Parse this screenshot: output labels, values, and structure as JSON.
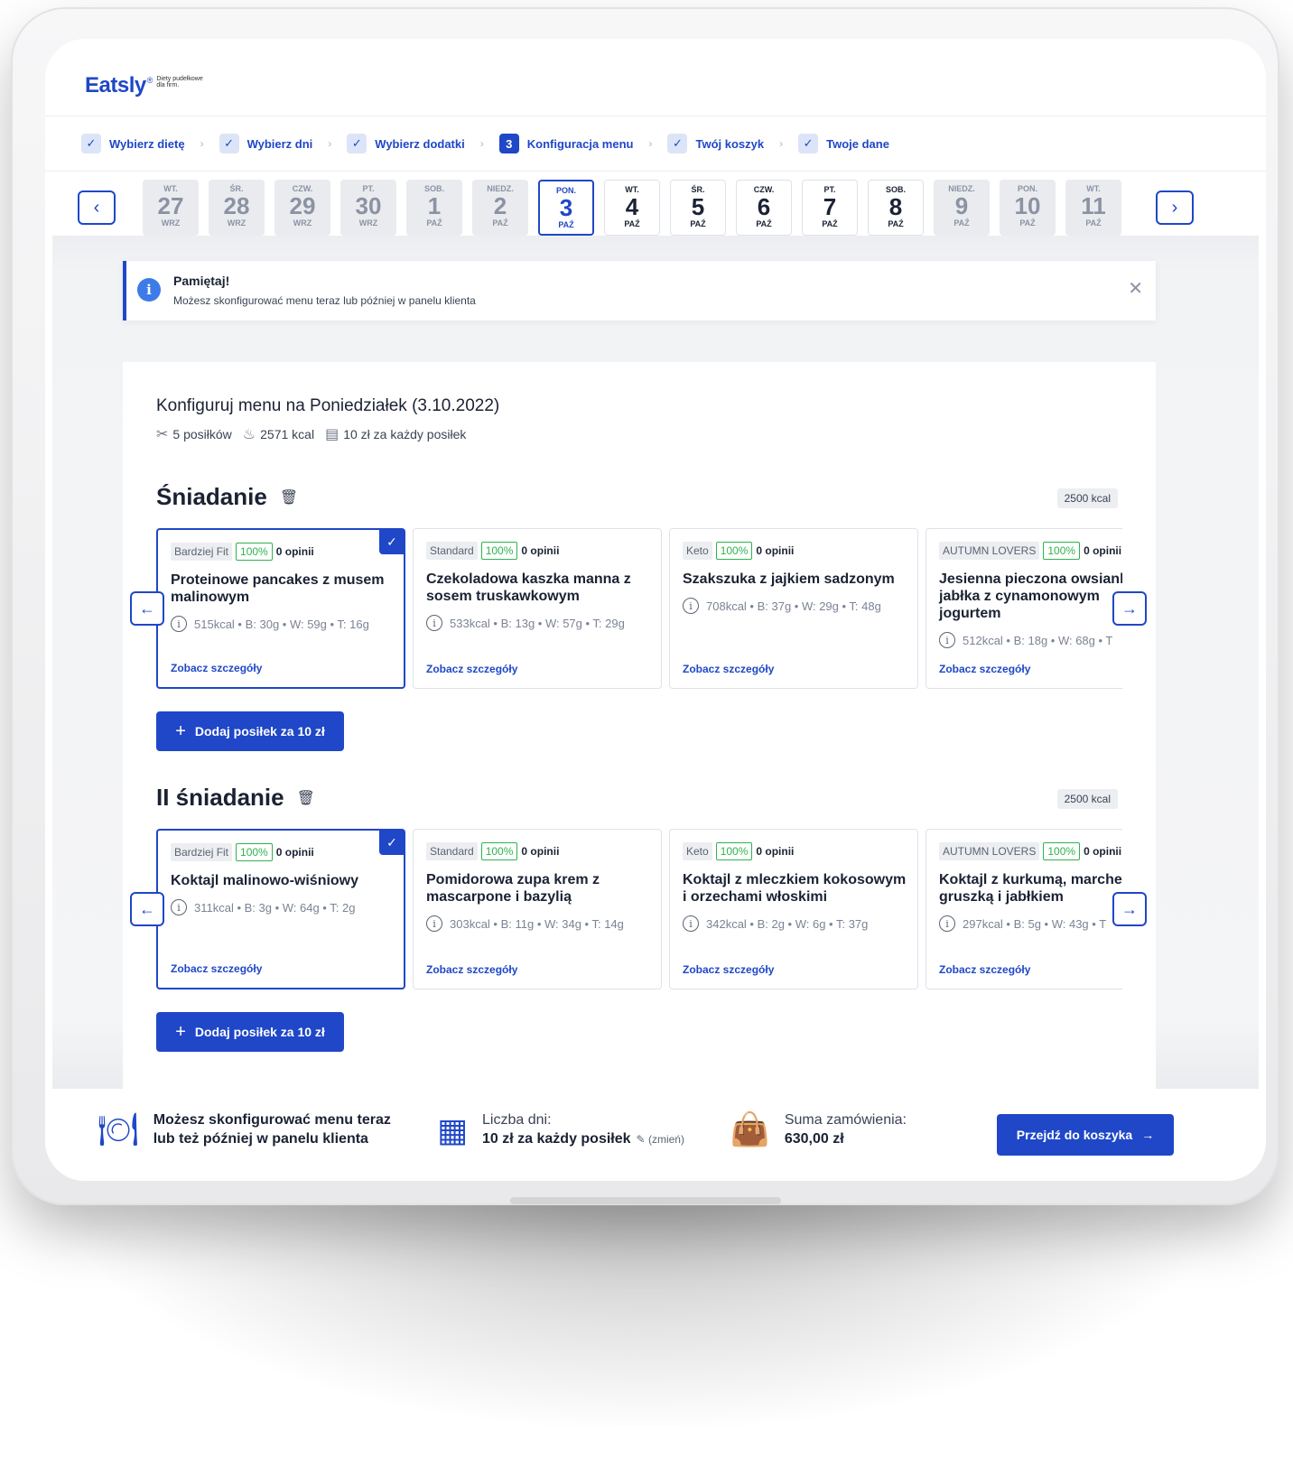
{
  "brand": {
    "name": "Eatsly",
    "reg": "®",
    "tagline": "Diety pudełkowe dla firm."
  },
  "steps": [
    {
      "label": "Wybierz dietę",
      "state": "done",
      "mark": "✓"
    },
    {
      "label": "Wybierz dni",
      "state": "done",
      "mark": "✓"
    },
    {
      "label": "Wybierz dodatki",
      "state": "done",
      "mark": "✓"
    },
    {
      "label": "Konfiguracja menu",
      "state": "current",
      "mark": "3"
    },
    {
      "label": "Twój koszyk",
      "state": "done",
      "mark": "✓"
    },
    {
      "label": "Twoje dane",
      "state": "done",
      "mark": "✓"
    }
  ],
  "days": [
    {
      "name": "WT.",
      "day": "27",
      "month": "WRZ",
      "state": "past"
    },
    {
      "name": "ŚR.",
      "day": "28",
      "month": "WRZ",
      "state": "past"
    },
    {
      "name": "CZW.",
      "day": "29",
      "month": "WRZ",
      "state": "past"
    },
    {
      "name": "PT.",
      "day": "30",
      "month": "WRZ",
      "state": "past"
    },
    {
      "name": "SOB.",
      "day": "1",
      "month": "PAŹ",
      "state": "past"
    },
    {
      "name": "NIEDZ.",
      "day": "2",
      "month": "PAŹ",
      "state": "past"
    },
    {
      "name": "PON.",
      "day": "3",
      "month": "PAŹ",
      "state": "active"
    },
    {
      "name": "WT.",
      "day": "4",
      "month": "PAŹ",
      "state": "future"
    },
    {
      "name": "ŚR.",
      "day": "5",
      "month": "PAŹ",
      "state": "future"
    },
    {
      "name": "CZW.",
      "day": "6",
      "month": "PAŹ",
      "state": "future"
    },
    {
      "name": "PT.",
      "day": "7",
      "month": "PAŹ",
      "state": "future"
    },
    {
      "name": "SOB.",
      "day": "8",
      "month": "PAŹ",
      "state": "future"
    },
    {
      "name": "NIEDZ.",
      "day": "9",
      "month": "PAŹ",
      "state": "past"
    },
    {
      "name": "PON.",
      "day": "10",
      "month": "PAŹ",
      "state": "past"
    },
    {
      "name": "WT.",
      "day": "11",
      "month": "PAŹ",
      "state": "past"
    }
  ],
  "alert": {
    "title": "Pamiętaj!",
    "text": "Możesz skonfigurować menu teraz lub później w panelu klienta"
  },
  "panel": {
    "title": "Konfiguruj menu na Poniedziałek (3.10.2022)",
    "meals": "5 posiłków",
    "kcal": "2571 kcal",
    "price": "10 zł za każdy posiłek"
  },
  "sections": [
    {
      "title": "Śniadanie",
      "kcal": "2500 kcal",
      "add_label": "Dodaj posiłek za 10 zł",
      "cards": [
        {
          "tag": "Bardziej Fit",
          "pct": "100%",
          "reviews": "0 opinii",
          "name": [
            "Proteinowe pancakes z musem",
            "malinowym"
          ],
          "nutrition": "515kcal • B: 30g • W: 59g • T: 16g",
          "link": "Zobacz szczegóły",
          "selected": true
        },
        {
          "tag": "Standard",
          "pct": "100%",
          "reviews": "0 opinii",
          "name": [
            "Czekoladowa kaszka manna z",
            "sosem truskawkowym"
          ],
          "nutrition": "533kcal • B: 13g • W: 57g • T: 29g",
          "link": "Zobacz szczegóły",
          "selected": false
        },
        {
          "tag": "Keto",
          "pct": "100%",
          "reviews": "0 opinii",
          "name": [
            "Szakszuka z jajkiem sadzonym"
          ],
          "nutrition": "708kcal • B: 37g • W: 29g • T: 48g",
          "link": "Zobacz szczegóły",
          "selected": false
        },
        {
          "tag": "AUTUMN LOVERS",
          "pct": "100%",
          "reviews": "0 opinii",
          "name": [
            "Jesienna pieczona owsianka z",
            "jabłka z cynamonowym",
            "jogurtem"
          ],
          "nutrition": "512kcal • B: 18g • W: 68g • T",
          "link": "Zobacz szczegóły",
          "selected": false
        }
      ]
    },
    {
      "title": "II śniadanie",
      "kcal": "2500 kcal",
      "add_label": "Dodaj posiłek za 10 zł",
      "cards": [
        {
          "tag": "Bardziej Fit",
          "pct": "100%",
          "reviews": "0 opinii",
          "name": [
            "Koktajl malinowo-wiśniowy"
          ],
          "nutrition": "311kcal • B: 3g • W: 64g • T: 2g",
          "link": "Zobacz szczegóły",
          "selected": true
        },
        {
          "tag": "Standard",
          "pct": "100%",
          "reviews": "0 opinii",
          "name": [
            "Pomidorowa zupa krem z",
            "mascarpone i bazylią"
          ],
          "nutrition": "303kcal • B: 11g • W: 34g • T: 14g",
          "link": "Zobacz szczegóły",
          "selected": false
        },
        {
          "tag": "Keto",
          "pct": "100%",
          "reviews": "0 opinii",
          "name": [
            "Koktajl z mleczkiem kokosowym",
            "i orzechami włoskimi"
          ],
          "nutrition": "342kcal • B: 2g • W: 6g • T: 37g",
          "link": "Zobacz szczegóły",
          "selected": false
        },
        {
          "tag": "AUTUMN LOVERS",
          "pct": "100%",
          "reviews": "0 opinii",
          "name": [
            "Koktajl z kurkumą, marchewką,",
            "gruszką i jabłkiem"
          ],
          "nutrition": "297kcal • B: 5g • W: 43g • T",
          "link": "Zobacz szczegóły",
          "selected": false
        }
      ]
    }
  ],
  "footer": {
    "info_line1": "Możesz skonfigurować menu teraz",
    "info_line2": "lub też później w panelu klienta",
    "days_label": "Liczba dni:",
    "days_value": "10 zł za każdy posiłek",
    "change_label": "(zmień)",
    "sum_label": "Suma zamówienia:",
    "sum_value": "630,00 zł",
    "cart_button": "Przejdź do koszyka"
  },
  "colors": {
    "accent": "#1f47c7",
    "success": "#2fb34e",
    "info": "#3c7be8"
  }
}
